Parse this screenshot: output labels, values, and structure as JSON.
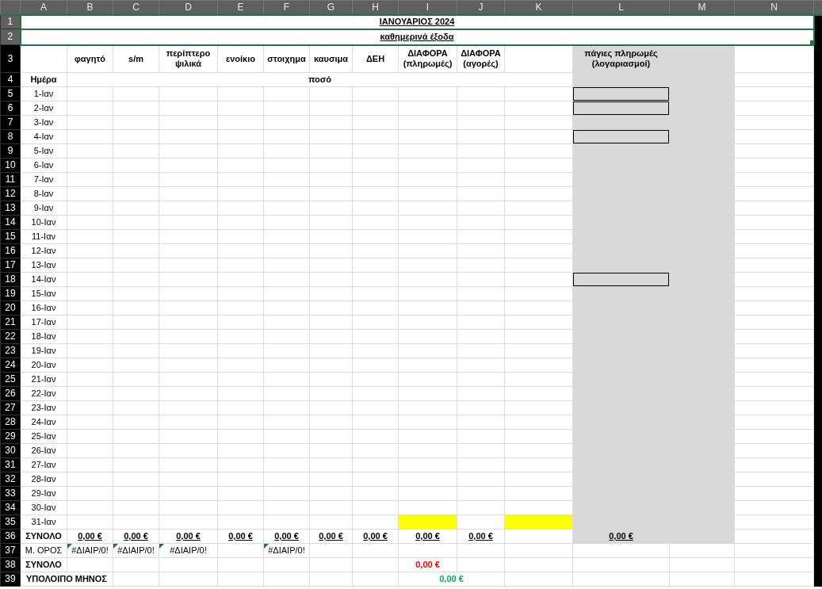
{
  "columns": [
    "A",
    "B",
    "C",
    "D",
    "E",
    "F",
    "G",
    "H",
    "I",
    "J",
    "K",
    "L",
    "M",
    "N"
  ],
  "title_row": {
    "number": "1",
    "text": "ΙΑΝΟΥΑΡΙΟΣ 2024",
    "selected": true
  },
  "subtitle_row": {
    "number": "2",
    "text": "καθημερινά  έξοδα",
    "selected": true
  },
  "header_row": {
    "number": "3",
    "categories": [
      "φαγητό",
      "s/m",
      "περίπτερο ψιλικά",
      "ενοίκιο",
      "στοιχημα",
      "καυσιμα",
      "ΔΕΗ",
      "ΔΙΑΦΟΡΑ (πληρωμές)",
      "ΔΙΑΦΟΡΑ (αγορές)"
    ],
    "fixed_payments": "πάγιες πληρωμές (λογαριασμοί)"
  },
  "label_row": {
    "number": "4",
    "day": "Ημέρα",
    "amount": "ποσό"
  },
  "days": [
    {
      "number": "5",
      "date": "1-Ιαν",
      "bill_box": true,
      "highlight": false
    },
    {
      "number": "6",
      "date": "2-Ιαν",
      "bill_box": true,
      "highlight": false
    },
    {
      "number": "7",
      "date": "3-Ιαν",
      "bill_box": false,
      "highlight": false
    },
    {
      "number": "8",
      "date": "4-Ιαν",
      "bill_box": true,
      "highlight": false
    },
    {
      "number": "9",
      "date": "5-Ιαν",
      "bill_box": false,
      "highlight": false
    },
    {
      "number": "10",
      "date": "6-Ιαν",
      "bill_box": false,
      "highlight": false
    },
    {
      "number": "11",
      "date": "7-Ιαν",
      "bill_box": false,
      "highlight": false
    },
    {
      "number": "12",
      "date": "8-Ιαν",
      "bill_box": false,
      "highlight": false
    },
    {
      "number": "13",
      "date": "9-Ιαν",
      "bill_box": false,
      "highlight": false
    },
    {
      "number": "14",
      "date": "10-Ιαν",
      "bill_box": false,
      "highlight": false
    },
    {
      "number": "15",
      "date": "11-Ιαν",
      "bill_box": false,
      "highlight": false
    },
    {
      "number": "16",
      "date": "12-Ιαν",
      "bill_box": false,
      "highlight": false
    },
    {
      "number": "17",
      "date": "13-Ιαν",
      "bill_box": false,
      "highlight": false
    },
    {
      "number": "18",
      "date": "14-Ιαν",
      "bill_box": true,
      "highlight": false
    },
    {
      "number": "19",
      "date": "15-Ιαν",
      "bill_box": false,
      "highlight": false
    },
    {
      "number": "20",
      "date": "16-Ιαν",
      "bill_box": false,
      "highlight": false
    },
    {
      "number": "21",
      "date": "17-Ιαν",
      "bill_box": false,
      "highlight": false
    },
    {
      "number": "22",
      "date": "18-Ιαν",
      "bill_box": false,
      "highlight": false
    },
    {
      "number": "23",
      "date": "19-Ιαν",
      "bill_box": false,
      "highlight": false
    },
    {
      "number": "24",
      "date": "20-Ιαν",
      "bill_box": false,
      "highlight": false
    },
    {
      "number": "25",
      "date": "21-Ιαν",
      "bill_box": false,
      "highlight": false
    },
    {
      "number": "26",
      "date": "22-Ιαν",
      "bill_box": false,
      "highlight": false
    },
    {
      "number": "27",
      "date": "23-Ιαν",
      "bill_box": false,
      "highlight": false
    },
    {
      "number": "28",
      "date": "24-Ιαν",
      "bill_box": false,
      "highlight": false
    },
    {
      "number": "29",
      "date": "25-Ιαν",
      "bill_box": false,
      "highlight": false
    },
    {
      "number": "30",
      "date": "26-Ιαν",
      "bill_box": false,
      "highlight": false
    },
    {
      "number": "31",
      "date": "27-Ιαν",
      "bill_box": false,
      "highlight": false
    },
    {
      "number": "32",
      "date": "28-Ιαν",
      "bill_box": false,
      "highlight": false
    },
    {
      "number": "33",
      "date": "29-Ιαν",
      "bill_box": false,
      "highlight": false
    },
    {
      "number": "34",
      "date": "30-Ιαν",
      "bill_box": false,
      "highlight": false
    },
    {
      "number": "35",
      "date": "31-Ιαν",
      "bill_box": false,
      "highlight": true
    }
  ],
  "totals_row": {
    "number": "36",
    "label": "ΣΥΝΟΛΟ",
    "values": [
      "0,00 €",
      "0,00 €",
      "0,00 €",
      "0,00 €",
      "0,00 €",
      "0,00 €",
      "0,00 €",
      "0,00 €",
      "0,00 €"
    ],
    "fixed_total": "0,00 €"
  },
  "average_row": {
    "number": "37",
    "label": "Μ. ΟΡΟΣ",
    "cells": [
      {
        "kind": "error",
        "text": "#ΔΙΑΙΡ/0!",
        "error_flag": true
      },
      {
        "kind": "error",
        "text": "#ΔΙΑΙΡ/0!",
        "error_flag": true
      },
      {
        "kind": "error",
        "text": "#ΔΙΑΙΡ/0!",
        "error_flag": true
      },
      {
        "kind": "blank"
      },
      {
        "kind": "error",
        "text": "#ΔΙΑΙΡ/0!",
        "error_flag": true
      },
      {
        "kind": "blank"
      },
      {
        "kind": "blank"
      },
      {
        "kind": "blank"
      },
      {
        "kind": "blank"
      }
    ]
  },
  "sum_row": {
    "number": "38",
    "label": "ΣΥΝΟΛΟ",
    "value": "0,00 €",
    "color": "#ff0000"
  },
  "balance_row": {
    "number": "39",
    "label": "ΥΠΟΛΟΙΠΟ ΜΗΝΟΣ",
    "value": "0,00 €",
    "color": "#00b050"
  }
}
